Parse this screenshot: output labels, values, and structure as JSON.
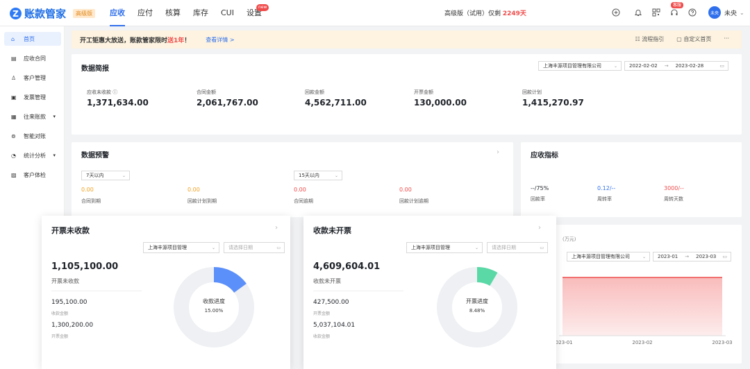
{
  "app": {
    "logo_letter": "Z",
    "name": "账款管家",
    "edition": "高级版"
  },
  "nav": {
    "items": [
      {
        "label": "应收",
        "active": true
      },
      {
        "label": "应付"
      },
      {
        "label": "核算"
      },
      {
        "label": "库存"
      },
      {
        "label": "CUI"
      },
      {
        "label": "设置",
        "badge": "new"
      }
    ]
  },
  "trial": {
    "prefix": "高级版（试用）仅剩 ",
    "days": "2249天"
  },
  "top_icons": [
    "plus-circle-icon",
    "bell-icon",
    "qrcode-icon",
    "headset-icon",
    "help-icon"
  ],
  "support_badge": "客服",
  "user": {
    "avatar_text": "未央",
    "name": "未央"
  },
  "sidebar": {
    "items": [
      {
        "label": "首页",
        "icon": "home-icon",
        "active": true
      },
      {
        "label": "应收合同",
        "icon": "contract-icon"
      },
      {
        "label": "客户管理",
        "icon": "customer-icon"
      },
      {
        "label": "发票管理",
        "icon": "invoice-icon"
      },
      {
        "label": "往来账款",
        "icon": "account-icon",
        "caret": true
      },
      {
        "label": "智能对账",
        "icon": "reconcile-icon"
      },
      {
        "label": "统计分析",
        "icon": "stats-icon",
        "caret": true
      },
      {
        "label": "客户体检",
        "icon": "checkup-icon"
      }
    ]
  },
  "banner": {
    "title_prefix": "开工钜惠大放送，账款管家限时",
    "title_highlight": "送1年",
    "title_suffix": "！",
    "link": "查看详情 >",
    "actions": [
      "流程指引",
      "自定义首页",
      "···"
    ]
  },
  "summary": {
    "title": "数据简报",
    "company": "上海丰源项目管理有限公司",
    "date_start": "2022-02-02",
    "date_end": "2023-02-28",
    "metrics": [
      {
        "label": "应收未收款 ⓘ",
        "value": "1,371,634.00"
      },
      {
        "label": "合同金额",
        "value": "2,061,767.00"
      },
      {
        "label": "回款金额",
        "value": "4,562,711.00"
      },
      {
        "label": "开票金额",
        "value": "130,000.00"
      },
      {
        "label": "回款计划",
        "value": "1,415,270.97"
      }
    ]
  },
  "warning": {
    "title": "数据预警",
    "select_left": "7天以内",
    "select_right": "15天以内",
    "items": [
      {
        "value": "0.00",
        "label": "合同到期",
        "color": "#f0a020"
      },
      {
        "value": "0.00",
        "label": "回款计划到期",
        "color": "#f0a020"
      },
      {
        "value": "0.00",
        "label": "合同逾期",
        "color": "#f04b4b"
      },
      {
        "value": "0.00",
        "label": "回款计划逾期",
        "color": "#f04b4b"
      }
    ]
  },
  "indicators": {
    "title": "应收指标",
    "items": [
      {
        "value": "--/75%",
        "label": "回款率"
      },
      {
        "value": "0.12/--",
        "label": "周转率",
        "color": "#2f6fec"
      },
      {
        "value": "3000/--",
        "label": "周转天数",
        "color": "#f04b4b"
      }
    ]
  },
  "trend": {
    "unit": "(万元)",
    "company": "上海丰源项目管理有限公司",
    "range_start": "2023-01",
    "range_end": "2023-03",
    "chart_data": {
      "type": "area",
      "categories": [
        "2023-01",
        "2023-02",
        "2023-03"
      ],
      "values": [
        null,
        null,
        null
      ],
      "fill_color": "#f8b4b4",
      "line_color": "#f04b4b"
    }
  },
  "invoiced_unpaid": {
    "title": "开票未收款",
    "company": "上海丰源项目管理",
    "date_placeholder": "请选择日期",
    "total": "1,105,100.00",
    "total_label": "开票未收款",
    "rows": [
      {
        "value": "195,100.00",
        "label": "收款金额"
      },
      {
        "value": "1,300,200.00",
        "label": "开票金额"
      }
    ],
    "progress_label": "收款进度",
    "progress_text": "15.00%",
    "progress": 0.15,
    "color": "#5b8ff9"
  },
  "paid_uninvoiced": {
    "title": "收款未开票",
    "company": "上海丰源项目管理",
    "date_placeholder": "请选择日期",
    "total": "4,609,604.01",
    "total_label": "收款未开票",
    "rows": [
      {
        "value": "427,500.00",
        "label": "开票金额"
      },
      {
        "value": "5,037,104.01",
        "label": "收款金额"
      }
    ],
    "progress_label": "开票进度",
    "progress_text": "8.48%",
    "progress": 0.0848,
    "color": "#5ad8a6"
  }
}
